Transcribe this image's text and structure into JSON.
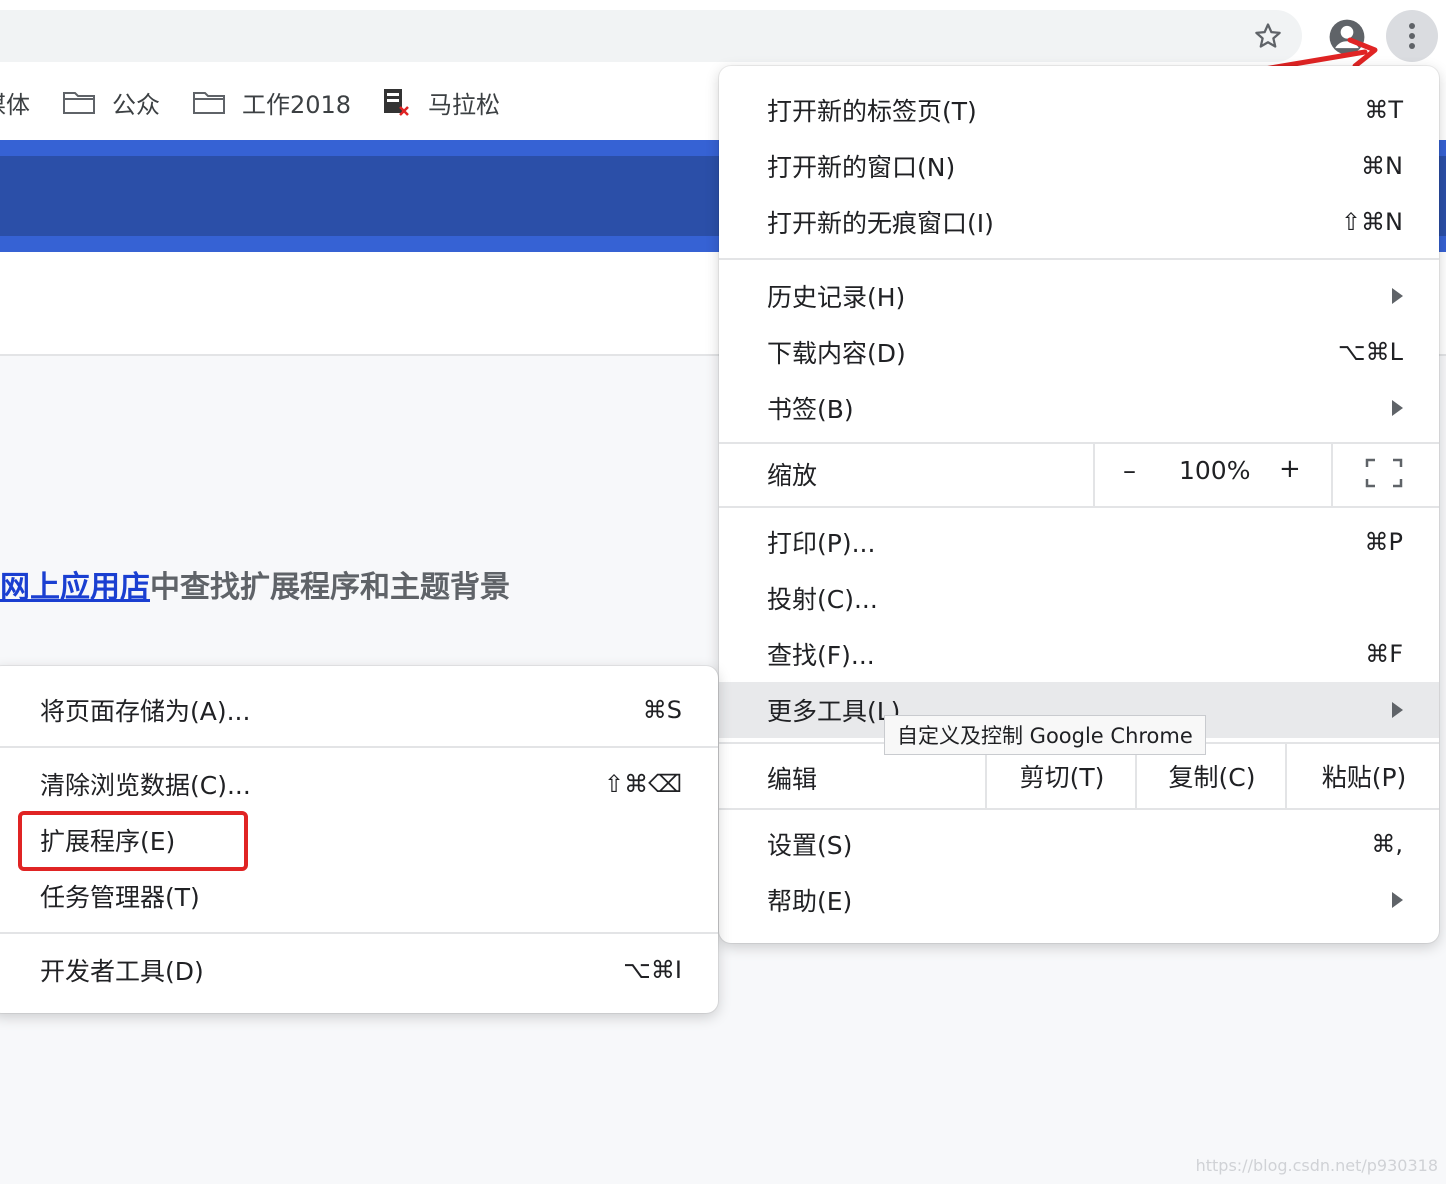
{
  "toolbar": {
    "star_icon": "star-icon",
    "avatar_icon": "account-icon",
    "menu_icon": "kebab-icon"
  },
  "bookmarks": [
    {
      "label": "媒体",
      "icon": "folder-icon"
    },
    {
      "label": "公众",
      "icon": "folder-icon"
    },
    {
      "label": "工作2018",
      "icon": "folder-icon"
    },
    {
      "label": "马拉松",
      "icon": "bookmark-file-icon"
    }
  ],
  "page": {
    "webstore_link": "网上应用店",
    "webstore_rest": "中查找扩展程序和主题背景",
    "watermark": "https://blog.csdn.net/p930318"
  },
  "main_menu": {
    "new_tab": {
      "label": "打开新的标签页(T)",
      "shortcut": "⌘T"
    },
    "new_window": {
      "label": "打开新的窗口(N)",
      "shortcut": "⌘N"
    },
    "incognito": {
      "label": "打开新的无痕窗口(I)",
      "shortcut": "⇧⌘N"
    },
    "history": {
      "label": "历史记录(H)"
    },
    "downloads": {
      "label": "下载内容(D)",
      "shortcut": "⌥⌘L"
    },
    "bookmarks": {
      "label": "书签(B)"
    },
    "zoom": {
      "label": "缩放",
      "minus": "–",
      "value": "100%",
      "plus": "+"
    },
    "print": {
      "label": "打印(P)...",
      "shortcut": "⌘P"
    },
    "cast": {
      "label": "投射(C)..."
    },
    "find": {
      "label": "查找(F)...",
      "shortcut": "⌘F"
    },
    "more_tools": {
      "label": "更多工具(L)"
    },
    "edit": {
      "label": "编辑",
      "cut": "剪切(T)",
      "copy": "复制(C)",
      "paste": "粘贴(P)"
    },
    "settings": {
      "label": "设置(S)",
      "shortcut": "⌘,"
    },
    "help": {
      "label": "帮助(E)"
    }
  },
  "tooltip": "自定义及控制 Google Chrome",
  "sub_menu": {
    "save_page": {
      "label": "将页面存储为(A)...",
      "shortcut": "⌘S"
    },
    "clear_data": {
      "label": "清除浏览数据(C)...",
      "shortcut": "⇧⌘⌫"
    },
    "extensions": {
      "label": "扩展程序(E)"
    },
    "task_manager": {
      "label": "任务管理器(T)"
    },
    "devtools": {
      "label": "开发者工具(D)",
      "shortcut": "⌥⌘I"
    }
  },
  "annotation_colors": {
    "red": "#e02424",
    "highlight": "#e8e9eb"
  }
}
